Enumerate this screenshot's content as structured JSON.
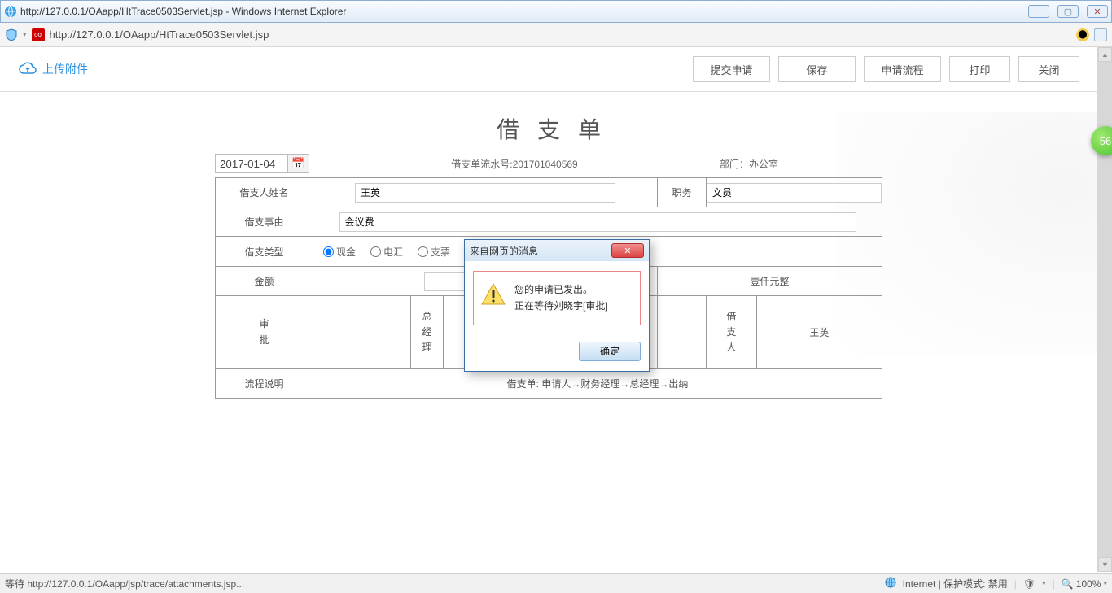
{
  "window": {
    "title": "http://127.0.0.1/OAapp/HtTrace0503Servlet.jsp - Windows Internet Explorer",
    "url": "http://127.0.0.1/OAapp/HtTrace0503Servlet.jsp"
  },
  "toolbar": {
    "upload": "上传附件",
    "submit": "提交申请",
    "save": "保存",
    "flow": "申请流程",
    "print": "打印",
    "close": "关闭"
  },
  "form": {
    "title": "借支单",
    "date": "2017-01-04",
    "serial_label": "借支单流水号:",
    "serial": "201701040569",
    "dept_label": "部门：",
    "dept": "办公室",
    "name_label": "借支人姓名",
    "name": "王英",
    "position_label": "职务",
    "position": "文员",
    "reason_label": "借支事由",
    "reason": "会议费",
    "type_label": "借支类型",
    "type_cash": "现金",
    "type_wire": "电汇",
    "type_check": "支票",
    "amount_label": "金额",
    "amount_cn": "壹仟元整",
    "approve_label": "审批",
    "gm_label": "总经理",
    "borrower_label": "借支人",
    "borrower": "王英",
    "flow_label": "流程说明",
    "flow_text": "借支单: 申请人→财务经理→总经理→出纳"
  },
  "dialog": {
    "title": "来自网页的消息",
    "line1": "您的申请已发出。",
    "line2": "正在等待刘晓宇[审批]",
    "ok": "确定"
  },
  "statusbar": {
    "left": "等待 http://127.0.0.1/OAapp/jsp/trace/attachments.jsp...",
    "zone": "Internet | 保护模式: 禁用",
    "zoom": "100%"
  },
  "badge": "56"
}
